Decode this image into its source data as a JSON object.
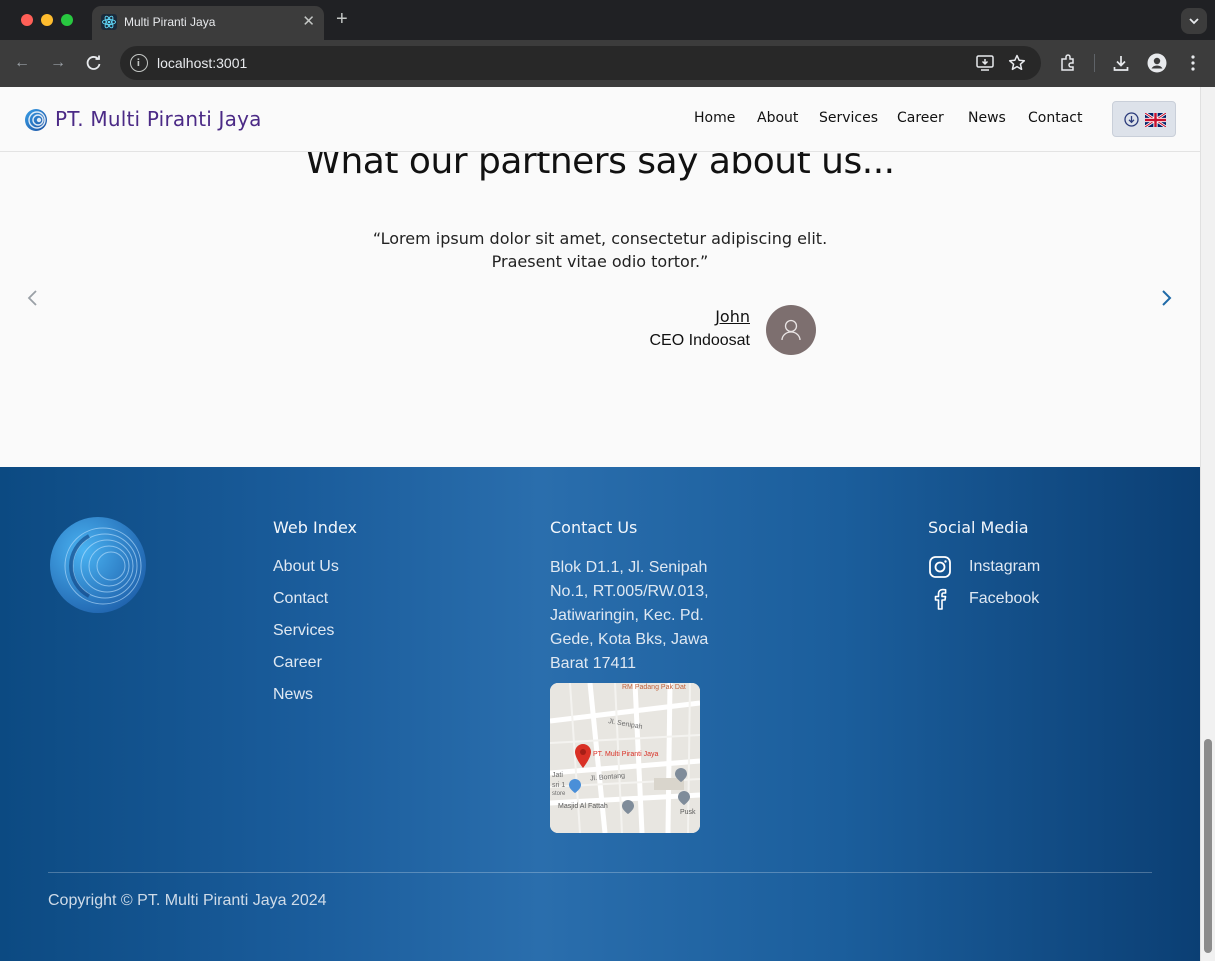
{
  "browser": {
    "tab_title": "Multi Piranti Jaya",
    "url": "localhost:3001"
  },
  "site": {
    "brand": "PT. Multi Piranti Jaya",
    "nav": [
      "Home",
      "About",
      "Services",
      "Career",
      "News",
      "Contact"
    ],
    "language_icon": "uk-flag-icon"
  },
  "testimonial": {
    "heading": "What our partners say about us...",
    "quote": "“Lorem ipsum dolor sit amet, consectetur adipiscing elit. Praesent vitae odio tortor.”",
    "author": "John",
    "role": "CEO Indoosat"
  },
  "footer": {
    "web_index": {
      "heading": "Web Index",
      "links": [
        "About Us",
        "Contact",
        "Services",
        "Career",
        "News"
      ]
    },
    "contact": {
      "heading": "Contact Us",
      "address": "Blok D1.1, Jl. Senipah No.1, RT.005/RW.013, Jatiwaringin, Kec. Pd. Gede, Kota Bks, Jawa Barat 17411",
      "map": {
        "place": "PT. Multi Piranti Jaya",
        "labels": [
          "RM Padang Pak Dat",
          "Jl. Senipah",
          "Jl. Bontang",
          "Jati",
          "sri 1",
          "store",
          "Masjid Al Fattah",
          "Pusk"
        ]
      }
    },
    "social": {
      "heading": "Social Media",
      "items": [
        "Instagram",
        "Facebook"
      ]
    },
    "copyright": "Copyright © PT. Multi Piranti Jaya 2024"
  },
  "colors": {
    "brand": "#4b2a86",
    "footer_blue": "#1a5c9b",
    "arrow_active": "#1f6aa8",
    "pin_red": "#d93025"
  }
}
